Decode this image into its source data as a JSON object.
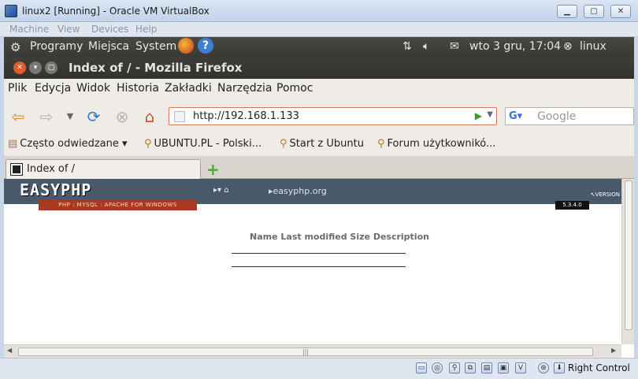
{
  "vbox": {
    "title": "linux2 [Running] - Oracle VM VirtualBox",
    "menu": [
      "Machine",
      "View",
      "Devices",
      "Help"
    ],
    "host_key": "Right Control"
  },
  "gnome_panel": {
    "menus": [
      "Programy",
      "Miejsca",
      "System"
    ],
    "clock": "wto  3 gru, 17:04",
    "user": "linux"
  },
  "firefox": {
    "window_title": "Index of / - Mozilla Firefox",
    "menu": [
      "Plik",
      "Edycja",
      "Widok",
      "Historia",
      "Zakładki",
      "Narzędzia",
      "Pomoc"
    ],
    "url": "http://192.168.1.133",
    "search_placeholder": "Google",
    "bookmarks": [
      "Często odwiedzane ▾",
      "UBUNTU.PL - Polski...",
      "Start z Ubuntu",
      "Forum użytkownikó..."
    ],
    "tab_title": "Index of /"
  },
  "page": {
    "logo": "EASYPHP",
    "tagline": "PHP : MYSQL : APACHE FOR WINDOWS",
    "nav_link": "easyphp.org",
    "version_label": "VERSION",
    "version": "5.3.4.0",
    "listing_header": "Name Last modified Size Description"
  }
}
